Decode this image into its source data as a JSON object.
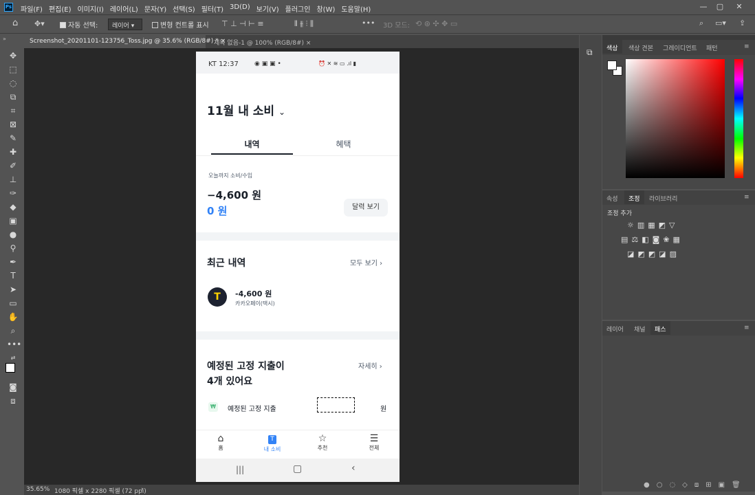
{
  "app": {
    "logo": "Ps",
    "menus": [
      "파일(F)",
      "편집(E)",
      "이미지(I)",
      "레이어(L)",
      "문자(Y)",
      "선택(S)",
      "필터(T)",
      "3D(D)",
      "보기(V)",
      "플러그인",
      "창(W)",
      "도움말(H)"
    ]
  },
  "options": {
    "auto_select_label": "자동 선택:",
    "auto_select_value": "레이어",
    "transform_label": "변형 컨트롤 표시",
    "mode_3d": "3D 모드:"
  },
  "tabs": [
    {
      "label": "Screenshot_20201101-123756_Toss.jpg @ 35.6% (RGB/8#) *"
    },
    {
      "label": "제목 없음-1 @ 100% (RGB/8#)"
    }
  ],
  "status": {
    "zoom": "35.65%",
    "info": "1080 픽셀 x 2280 픽셀 (72 ppi)"
  },
  "phone": {
    "statusbar": {
      "left": "KT 12:37",
      "right": "⏰ ✕ ≋ ▭ .ıl ▮"
    },
    "header_title": "11월 내 소비",
    "tabs": [
      "내역",
      "혜택"
    ],
    "summary": {
      "label": "오늘까지 소비/수입",
      "spend": "−4,600 원",
      "income": "0 원",
      "calendar_btn": "달력 보기"
    },
    "recent": {
      "title": "최근 내역",
      "more": "모두 보기",
      "items": [
        {
          "amount": "-4,600 원",
          "merchant": "카카오페이(택시)"
        }
      ]
    },
    "fixed": {
      "title_line1": "예정된 고정 지출이",
      "title_line2": "4개 있어요",
      "more": "자세히",
      "row_label": "예정된 고정 지출",
      "row_unit": "원"
    },
    "bottom_nav": [
      "홈",
      "내 소비",
      "추천",
      "전체"
    ]
  },
  "right": {
    "color_tabs": [
      "색상",
      "색상 견본",
      "그레이디언트",
      "패턴"
    ],
    "adj_tabs": [
      "속성",
      "조정",
      "라이브러리"
    ],
    "adj_title": "조정 추가",
    "layer_tabs": [
      "레이어",
      "채널",
      "패스"
    ]
  },
  "colors": {
    "accent": "#3182f6",
    "income": "#3182f6"
  }
}
